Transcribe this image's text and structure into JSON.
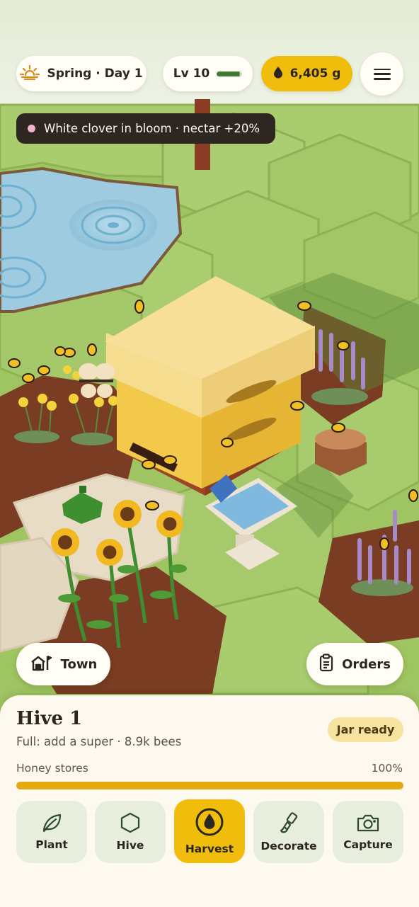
{
  "hud": {
    "season": "Spring · Day 1",
    "level": "Lv 10",
    "level_progress": 0.9,
    "gold": "6,405 g"
  },
  "event_banner": "White clover in bloom · nectar +20%",
  "nav": {
    "town_label": "Town",
    "orders_label": "Orders"
  },
  "hive": {
    "title": "Hive 1",
    "subtitle": "Full: add a super · 8.9k bees",
    "badge": "Jar ready",
    "stores_label": "Honey stores",
    "stores_value": "100%",
    "stores_fraction": 1.0
  },
  "toolbar": [
    {
      "label": "Plant",
      "icon": "leaf-icon",
      "active": false
    },
    {
      "label": "Hive",
      "icon": "hexagon-icon",
      "active": false
    },
    {
      "label": "Harvest",
      "icon": "honey-drop-icon",
      "active": true
    },
    {
      "label": "Decorate",
      "icon": "paintbrush-icon",
      "active": false
    },
    {
      "label": "Capture",
      "icon": "camera-icon",
      "active": false
    }
  ],
  "colors": {
    "accent": "#f1bd0c",
    "panel": "#fdf9ef",
    "grass": "#a6c96a",
    "soil": "#7a3c22",
    "water": "#9fcbe0"
  }
}
